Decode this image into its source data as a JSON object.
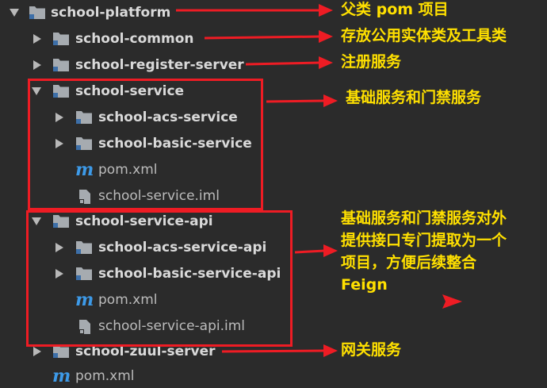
{
  "tree": {
    "platform": "school-platform",
    "common": "school-common",
    "register": "school-register-server",
    "service": "school-service",
    "acs_service": "school-acs-service",
    "basic_service": "school-basic-service",
    "pom": "pom.xml",
    "service_iml": "school-service.iml",
    "service_api": "school-service-api",
    "acs_api": "school-acs-service-api",
    "basic_api": "school-basic-service-api",
    "pom2": "pom.xml",
    "api_iml": "school-service-api.iml",
    "zuul": "school-zuul-server",
    "pom3": "pom.xml",
    "m_letter": "m"
  },
  "notes": {
    "parent": "父类 pom 项目",
    "common": "存放公用实体类及工具类",
    "register": "注册服务",
    "service": "基础服务和门禁服务",
    "api_line1": "基础服务和门禁服务对外",
    "api_line2": "提供接口专门提取为一个",
    "api_line3": "项目，方便后续整合",
    "api_line4": "Feign",
    "gateway": "网关服务"
  },
  "colors": {
    "background": "#2b2b2b",
    "annotation": "#ee1c24",
    "note_text": "#ffe000",
    "maven_icon": "#3d9ae8"
  }
}
